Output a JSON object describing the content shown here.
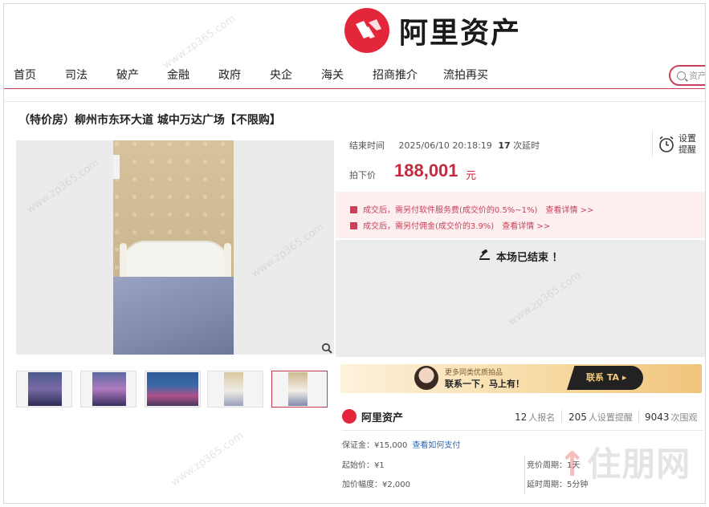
{
  "brand": {
    "name": "阿里资产",
    "accent": "#e4263a"
  },
  "nav": {
    "items": [
      "首页",
      "司法",
      "破产",
      "金融",
      "政府",
      "央企",
      "海关",
      "招商推介",
      "流拍再买"
    ],
    "search_placeholder": "资产",
    "accent": "#c8405a"
  },
  "listing": {
    "title": "（特价房）柳州市东环大道 城中万达广场【不限购】"
  },
  "auction": {
    "end_label": "结束时间",
    "end_time": "2025/06/10 20:18:19",
    "delay_count": "17",
    "delay_label": "次延时",
    "reminder_label": "设置提醒",
    "price_label": "拍下价",
    "price": "188,001",
    "price_unit": "元",
    "price_color": "#c62a3e"
  },
  "notices": [
    {
      "text": "成交后，需另付软件服务费(成交价的0.5%~1%)",
      "more": "查看详情 >>"
    },
    {
      "text": "成交后，需另付佣金(成交价的3.9%)",
      "more": "查看详情 >>"
    }
  ],
  "status": {
    "text": "本场已结束 ！"
  },
  "banner": {
    "small": "更多同类优质拍品",
    "big": "联系一下，马上有！",
    "cta": "联系 TA ▸"
  },
  "stats": {
    "signups": "12",
    "signups_unit": "人报名",
    "reminders": "205",
    "reminders_unit": "人设置提醒",
    "views": "9043",
    "views_unit": "次围观"
  },
  "details": {
    "deposit": "保证金：¥15,000",
    "deposit_link": "查看如何支付",
    "start_price": "起始价：¥1",
    "increment": "加价幅度：¥2,000",
    "bid_period": "竞价周期：1天",
    "delay_period": "延时周期：5分钟"
  },
  "watermark": {
    "text": "住朋网",
    "site": "www.zp365.com"
  },
  "thumbnails": [
    {
      "name": "thumb-building-night-1"
    },
    {
      "name": "thumb-building-night-2"
    },
    {
      "name": "thumb-city-skyline"
    },
    {
      "name": "thumb-room-interior"
    },
    {
      "name": "thumb-bedroom"
    }
  ]
}
